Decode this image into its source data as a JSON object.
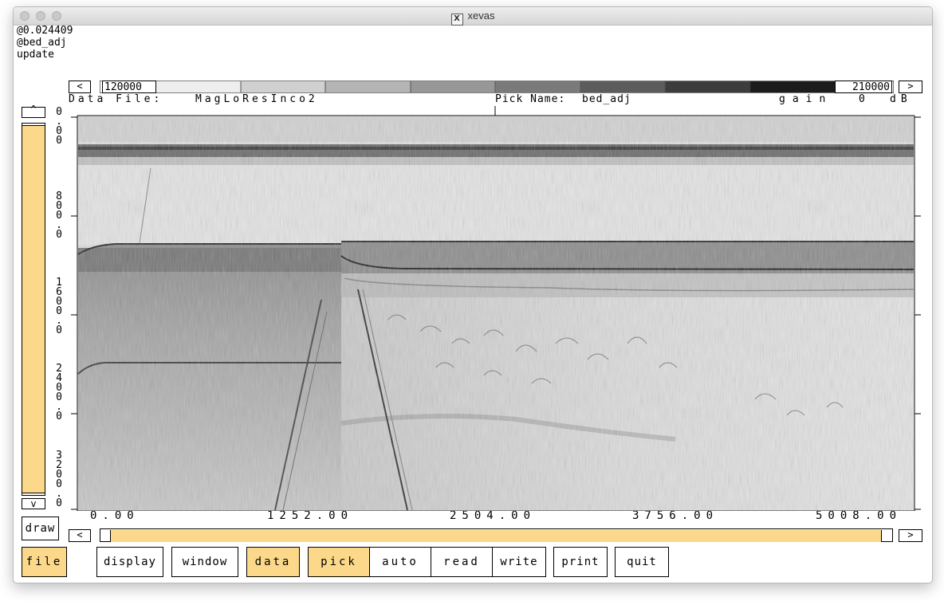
{
  "window": {
    "title": "xevas"
  },
  "status_lines": [
    "@0.024409",
    "@bed_adj",
    "update"
  ],
  "colorbar": {
    "left_arrow": "<",
    "right_arrow": ">",
    "min": "120000",
    "max": "210000"
  },
  "header": {
    "data_file_label": "Data File:",
    "data_file": "MagLoResInco2",
    "pick_name_label": "Pick Name:",
    "pick_name": "bed_adj",
    "gain_label": "gain",
    "gain_value": "0",
    "gain_unit": "dB"
  },
  "vertical_scroll": {
    "up": "^",
    "down": "v"
  },
  "y_ticks": [
    {
      "chars": [
        "0",
        ".",
        "0",
        "0"
      ]
    },
    {
      "chars": [
        "8",
        "0",
        "0",
        ".",
        "0"
      ]
    },
    {
      "chars": [
        "1",
        "6",
        "0",
        "0",
        ".",
        "0"
      ]
    },
    {
      "chars": [
        "2",
        "4",
        "0",
        "0",
        ".",
        "0"
      ]
    },
    {
      "chars": [
        "3",
        "2",
        "0",
        "0",
        ".",
        "0"
      ]
    }
  ],
  "x_ticks": [
    "0.00",
    "1252.00",
    "2504.00",
    "3756.00",
    "5008.00"
  ],
  "draw_button": "draw",
  "horizontal_scroll": {
    "left": "<",
    "right": ">"
  },
  "menu": [
    {
      "label": "file",
      "active": true
    },
    {
      "label": "display",
      "active": false
    },
    {
      "label": "window",
      "active": false
    },
    {
      "label": "data",
      "active": true
    },
    {
      "label": "pick",
      "active": true
    },
    {
      "label": "auto",
      "active": false
    },
    {
      "label": "read",
      "active": false
    },
    {
      "label": "write",
      "active": false
    },
    {
      "label": "print",
      "active": false
    },
    {
      "label": "quit",
      "active": false
    }
  ],
  "colors": {
    "accent": "#fcd98a",
    "frame": "#000000",
    "background": "#ffffff"
  },
  "icons": [
    "close-icon",
    "minimize-icon",
    "zoom-icon",
    "x11-logo-icon"
  ]
}
